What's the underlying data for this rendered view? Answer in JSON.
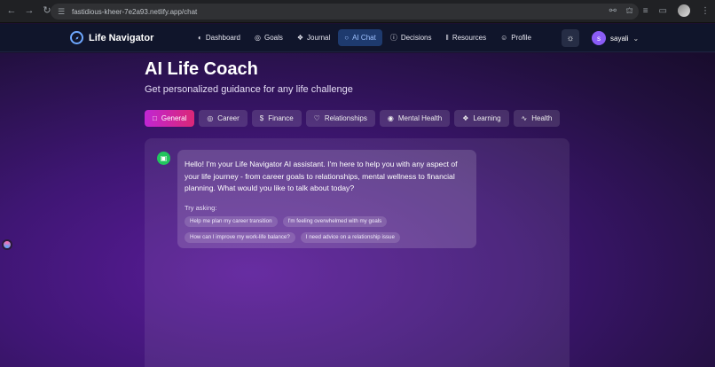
{
  "browser": {
    "url": "fastidious-kheer-7e2a93.netlify.app/chat"
  },
  "app": {
    "brand": "Life Navigator",
    "nav": [
      {
        "label": "Dashboard",
        "icon": "dashboard-icon"
      },
      {
        "label": "Goals",
        "icon": "target-icon"
      },
      {
        "label": "Journal",
        "icon": "book-icon"
      },
      {
        "label": "AI Chat",
        "icon": "chat-icon"
      },
      {
        "label": "Decisions",
        "icon": "help-circle-icon"
      },
      {
        "label": "Resources",
        "icon": "library-icon"
      },
      {
        "label": "Profile",
        "icon": "user-icon"
      }
    ],
    "active_nav": "AI Chat",
    "user": {
      "initial": "s",
      "name": "sayali"
    }
  },
  "page": {
    "title": "AI Life Coach",
    "subtitle": "Get personalized guidance for any life challenge",
    "tabs": [
      {
        "label": "General",
        "icon": "chat-icon"
      },
      {
        "label": "Career",
        "icon": "target-icon"
      },
      {
        "label": "Finance",
        "icon": "dollar-icon"
      },
      {
        "label": "Relationships",
        "icon": "heart-icon"
      },
      {
        "label": "Mental Health",
        "icon": "brain-icon"
      },
      {
        "label": "Learning",
        "icon": "book-icon"
      },
      {
        "label": "Health",
        "icon": "activity-icon"
      }
    ],
    "active_tab": "General"
  },
  "chat": {
    "message": "Hello! I'm your Life Navigator AI assistant. I'm here to help you with any aspect of your life journey - from career goals to relationships, mental wellness to financial planning. What would you like to talk about today?",
    "try_label": "Try asking:",
    "suggestions": [
      "Help me plan my career transition",
      "I'm feeling overwhelmed with my goals",
      "How can I improve my work-life balance?",
      "I need advice on a relationship issue"
    ]
  },
  "colors": {
    "accent_active_tab": "#c026d3",
    "bot_avatar": "#22c55e",
    "nav_active": "#1e3a6e"
  }
}
